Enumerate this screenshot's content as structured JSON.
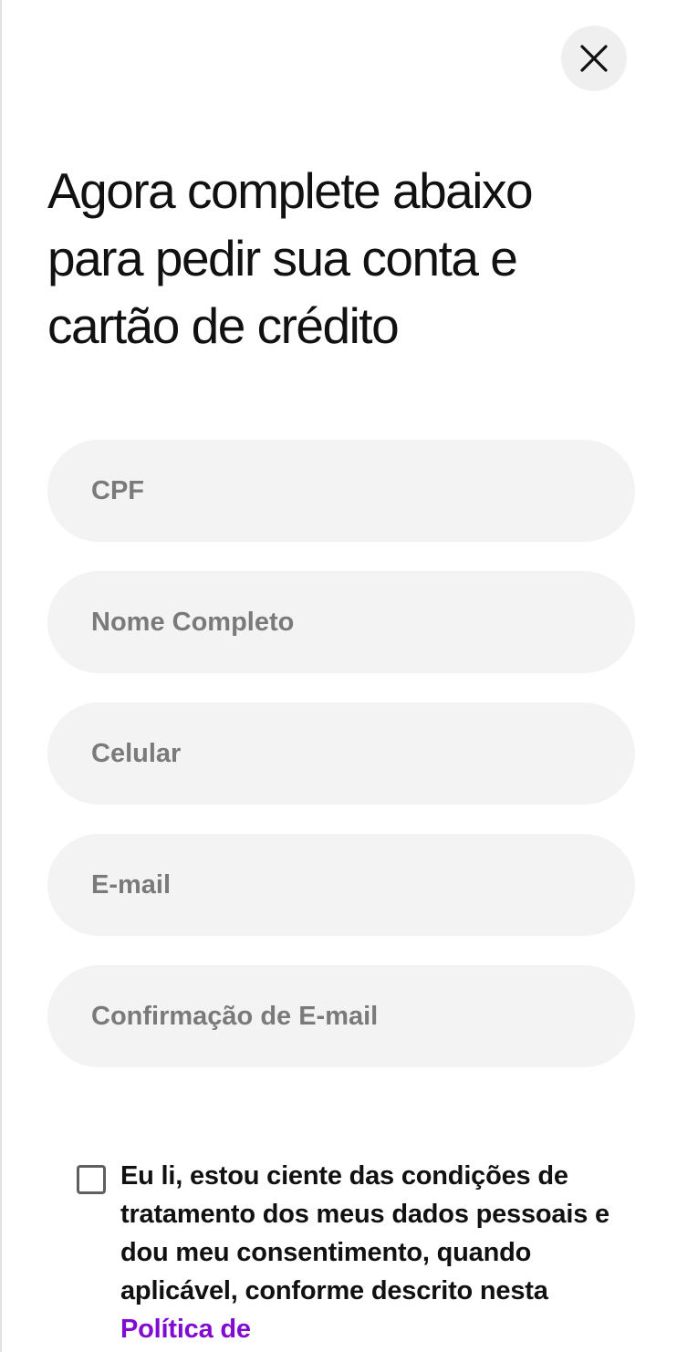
{
  "header": {
    "close_icon": "close-icon",
    "title": "Agora complete abaixo para pedir sua conta e cartão de crédito"
  },
  "form": {
    "cpf_placeholder": "CPF",
    "name_placeholder": "Nome Completo",
    "phone_placeholder": "Celular",
    "email_placeholder": "E-mail",
    "email_confirm_placeholder": "Confirmação de E-mail"
  },
  "consent": {
    "checked": false,
    "text": "Eu li, estou ciente das condições de tratamento dos meus dados pessoais e dou meu consentimento, quando aplicável, conforme descrito nesta",
    "link_text": "Política de"
  },
  "colors": {
    "accent": "#820ad1",
    "field_background": "#f3f3f3",
    "close_button_background": "#efefef",
    "placeholder": "#7a7a7a",
    "text": "#111111"
  }
}
